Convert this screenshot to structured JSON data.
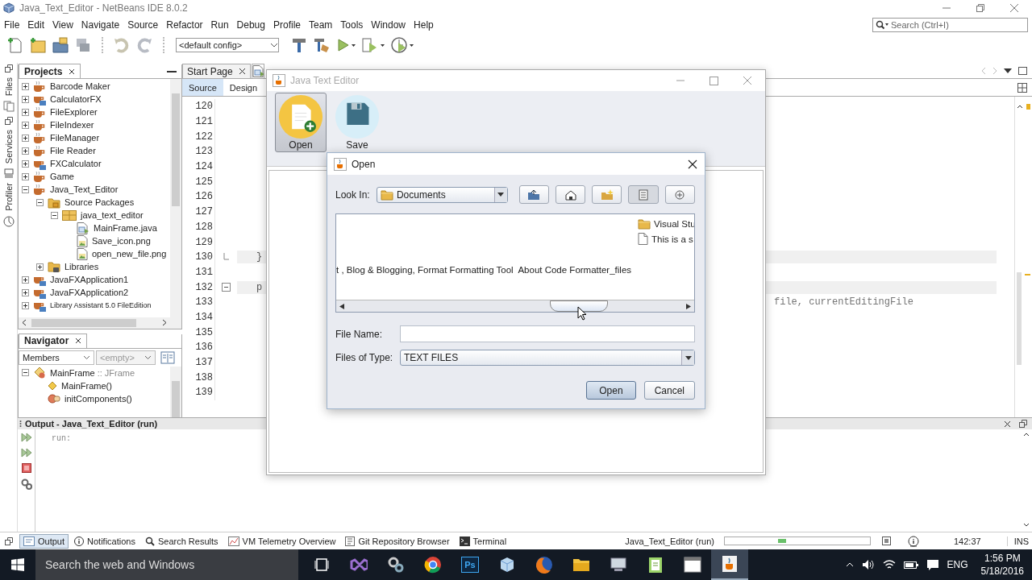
{
  "ide": {
    "title": "Java_Text_Editor - NetBeans IDE 8.0.2",
    "menus": [
      "File",
      "Edit",
      "View",
      "Navigate",
      "Source",
      "Refactor",
      "Run",
      "Debug",
      "Profile",
      "Team",
      "Tools",
      "Window",
      "Help"
    ],
    "search": {
      "placeholder": "Search (Ctrl+I)"
    },
    "config": "<default config>"
  },
  "side_tabs": [
    "Files",
    "Services",
    "Profiler"
  ],
  "projects": {
    "title": "Projects",
    "tree": [
      {
        "label": "Barcode Maker",
        "kind": "project",
        "expanded": false
      },
      {
        "label": "CalculatorFX",
        "kind": "fx",
        "expanded": false
      },
      {
        "label": "FileExplorer",
        "kind": "project",
        "expanded": false
      },
      {
        "label": "FileIndexer",
        "kind": "project",
        "expanded": false
      },
      {
        "label": "FileManager",
        "kind": "project",
        "expanded": false
      },
      {
        "label": "File Reader",
        "kind": "project",
        "expanded": false
      },
      {
        "label": "FXCalculator",
        "kind": "fx",
        "expanded": false
      },
      {
        "label": "Game",
        "kind": "project",
        "expanded": false
      },
      {
        "label": "Java_Text_Editor",
        "kind": "project",
        "expanded": true,
        "children": [
          {
            "label": "Source Packages",
            "kind": "folder",
            "expanded": true,
            "children": [
              {
                "label": "java_text_editor",
                "kind": "package",
                "expanded": true,
                "children": [
                  {
                    "label": "MainFrame.java",
                    "kind": "java"
                  },
                  {
                    "label": "Save_icon.png",
                    "kind": "image"
                  },
                  {
                    "label": "open_new_file.png",
                    "kind": "image"
                  }
                ]
              }
            ]
          },
          {
            "label": "Libraries",
            "kind": "library",
            "expanded": false
          }
        ]
      },
      {
        "label": "JavaFXApplication1",
        "kind": "fx",
        "expanded": false
      },
      {
        "label": "JavaFXApplication2",
        "kind": "fx",
        "expanded": false
      },
      {
        "label": "Library Assistant 5.0 FileEdition",
        "kind": "fx",
        "expanded": false
      }
    ]
  },
  "navigator": {
    "title": "Navigator",
    "filter": "Members",
    "scope": "<empty>",
    "tree": [
      {
        "label": "MainFrame",
        "type": ":: JFrame",
        "kind": "class",
        "expanded": true,
        "children": [
          {
            "label": "MainFrame()",
            "kind": "constructor"
          },
          {
            "label": "initComponents()",
            "kind": "method"
          }
        ]
      }
    ]
  },
  "editor": {
    "tabs": [
      {
        "label": "Start Page",
        "selected": false
      },
      {
        "kind": "form",
        "selected": true
      }
    ],
    "views": [
      {
        "label": "Source",
        "selected": true
      },
      {
        "label": "Design",
        "selected": false
      }
    ],
    "lines": [
      {
        "number": "120"
      },
      {
        "number": "121"
      },
      {
        "number": "122"
      },
      {
        "number": "123"
      },
      {
        "number": "124"
      },
      {
        "number": "125"
      },
      {
        "number": "126"
      },
      {
        "number": "127"
      },
      {
        "number": "128"
      },
      {
        "number": "129"
      },
      {
        "number": "130",
        "code": "}",
        "highlighted": true,
        "kind": "fold_end"
      },
      {
        "number": "131"
      },
      {
        "number": "132",
        "code": "p",
        "highlighted": true,
        "kind": "fold_start"
      },
      {
        "number": "133",
        "code": "file, currentEditingFile",
        "behind_window": true
      },
      {
        "number": "134"
      },
      {
        "number": "135"
      },
      {
        "number": "136"
      },
      {
        "number": "137"
      },
      {
        "number": "138"
      },
      {
        "number": "139"
      }
    ]
  },
  "output": {
    "title": "Output - Java_Text_Editor (run)",
    "text": "run:"
  },
  "bottom_tabs": [
    {
      "label": "Output",
      "kind": "output",
      "selected": true
    },
    {
      "label": "Notifications",
      "kind": "notifications",
      "selected": false
    },
    {
      "label": "Search Results",
      "kind": "search",
      "selected": false
    },
    {
      "label": "VM Telemetry Overview",
      "kind": "telemetry",
      "selected": false
    },
    {
      "label": "Git Repository Browser",
      "kind": "git",
      "selected": false
    },
    {
      "label": "Terminal",
      "kind": "terminal",
      "selected": false
    }
  ],
  "status": {
    "task": "Java_Text_Editor (run)",
    "busy": true,
    "position": "142:37",
    "mode": "INS"
  },
  "taskbar": {
    "search": {
      "placeholder": "Search the web and Windows"
    },
    "apps": [
      {
        "kind": "task-view",
        "selected": false
      },
      {
        "kind": "ribbon",
        "selected": false
      },
      {
        "kind": "gears",
        "selected": false
      },
      {
        "kind": "browser",
        "selected": false
      },
      {
        "kind": "ps",
        "label": "Ps",
        "selected": false
      },
      {
        "kind": "cube",
        "selected": false
      },
      {
        "kind": "globe",
        "selected": false
      },
      {
        "kind": "folder",
        "selected": false
      },
      {
        "kind": "computer",
        "selected": false
      },
      {
        "kind": "notepad",
        "selected": false
      },
      {
        "kind": "window",
        "selected": false
      },
      {
        "kind": "java",
        "selected": true
      }
    ],
    "language": "ENG",
    "time": "1:56 PM",
    "date": "5/18/2016"
  },
  "app_window": {
    "title": "Java Text Editor",
    "tools": [
      {
        "label": "Open",
        "kind": "open",
        "selected": true
      },
      {
        "label": "Save",
        "kind": "save",
        "selected": false
      }
    ]
  },
  "open_dialog": {
    "title": "Open",
    "look_in": {
      "label": "Look In:",
      "value": "Documents"
    },
    "files": [
      {
        "label": "Visual Stu",
        "kind": "folder"
      },
      {
        "label": "This is a s",
        "kind": "file"
      },
      {
        "label": "t , Blog & Blogging, Format Formatting Tool  About Code Formatter_files",
        "kind": "text"
      }
    ],
    "file_name": {
      "label": "File Name:"
    },
    "file_type": {
      "label": "Files of Type:",
      "value": "TEXT FILES"
    },
    "buttons": [
      {
        "label": "Open",
        "default": true
      },
      {
        "label": "Cancel",
        "default": false
      }
    ]
  }
}
